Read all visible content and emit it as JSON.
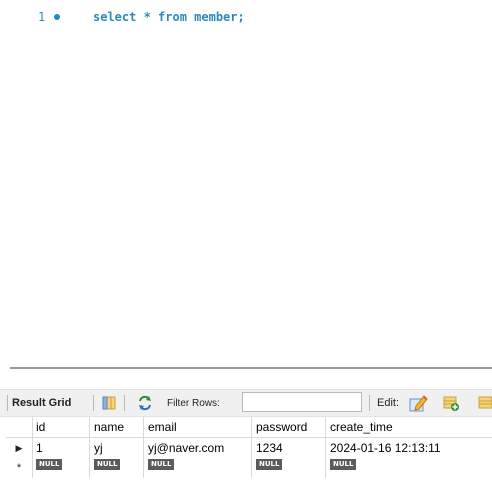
{
  "editor": {
    "line_number": "1",
    "sql": "select * from member;"
  },
  "toolbar": {
    "result_grid_label": "Result Grid",
    "filter_label": "Filter Rows:",
    "filter_value": "",
    "edit_label": "Edit:",
    "icons": [
      "grid-layout-icon",
      "filter-refresh-icon",
      "edit-pencil-icon",
      "add-row-icon",
      "delete-row-icon"
    ]
  },
  "results": {
    "columns": [
      "id",
      "name",
      "email",
      "password",
      "create_time"
    ],
    "rows": [
      [
        "1",
        "yj",
        "yj@naver.com",
        "1234",
        "2024-01-16 12:13:11"
      ]
    ],
    "new_row_marker": "*",
    "null_label": "NULL"
  },
  "colors": {
    "sql_text": "#2b8ab8",
    "line_number": "#2a8fb5",
    "null_badge": "#5b5b5b"
  }
}
